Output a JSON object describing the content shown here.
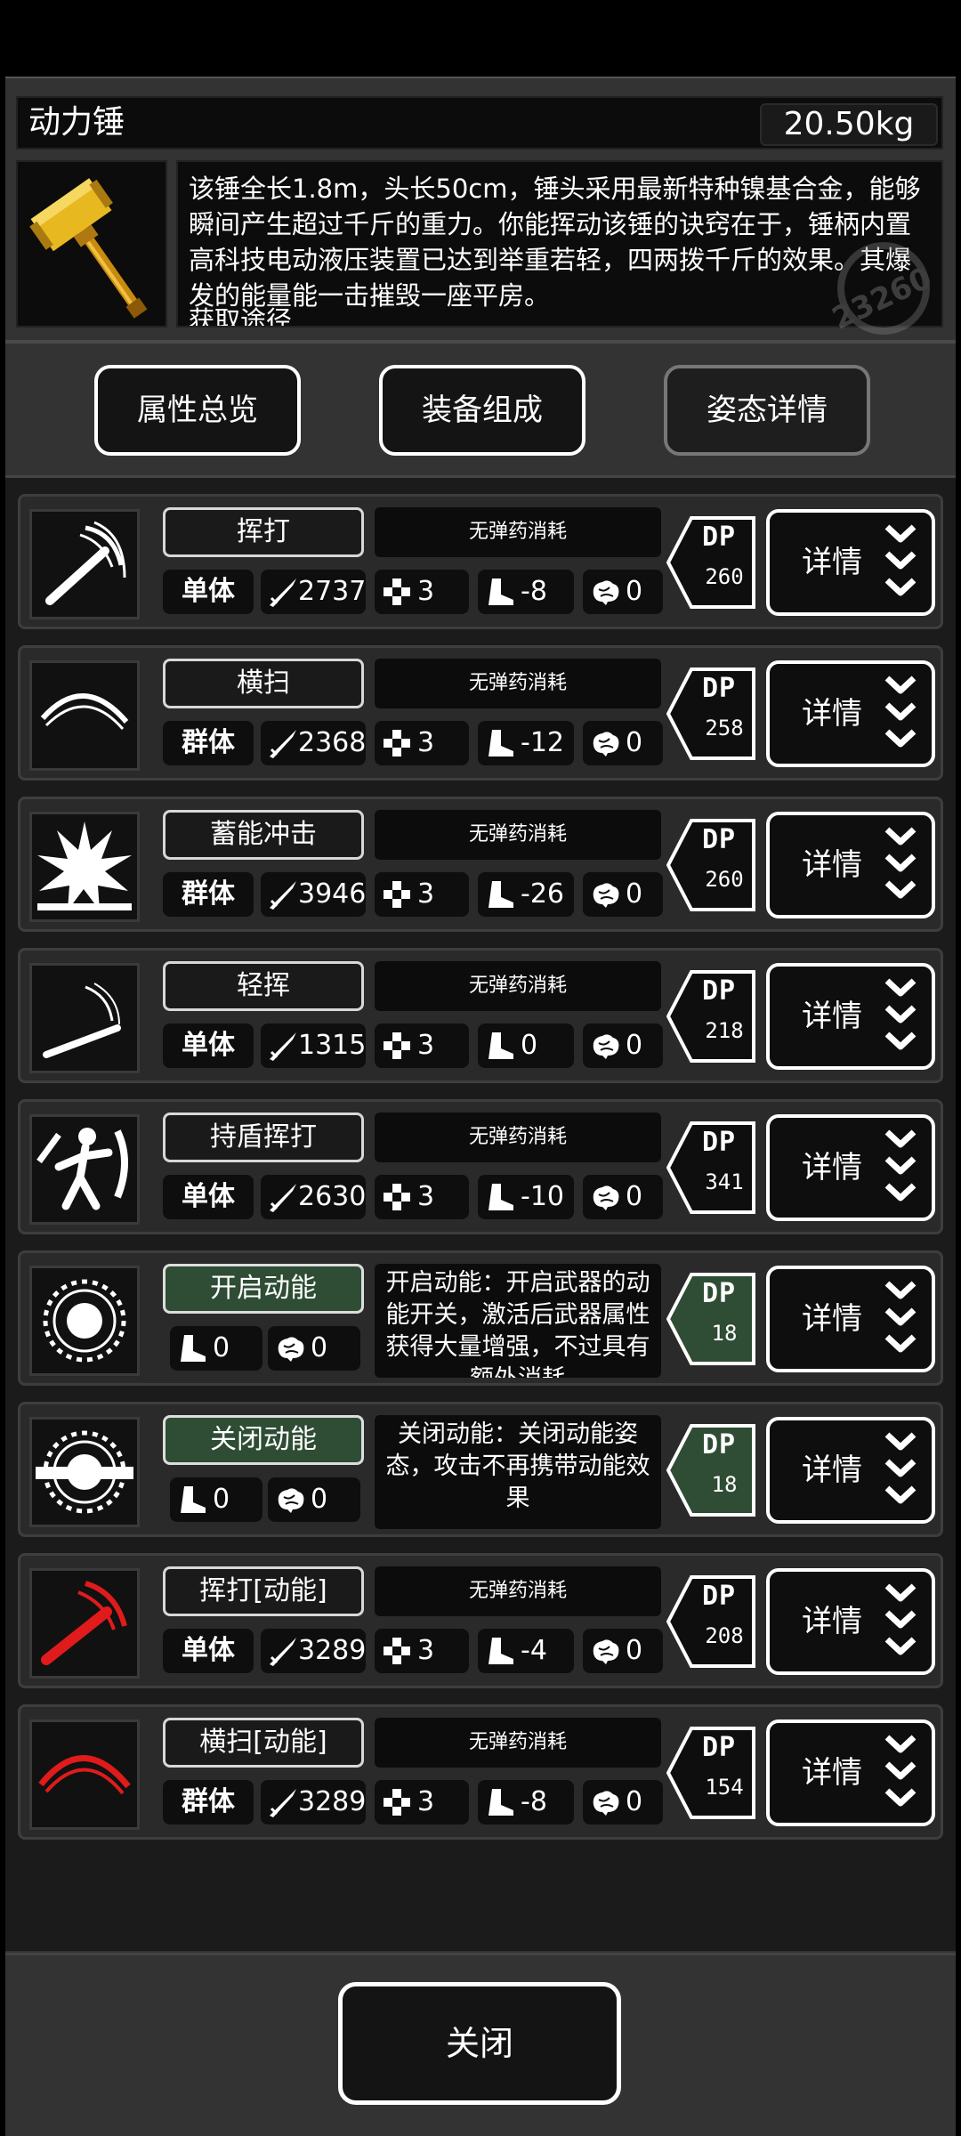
{
  "item": {
    "name": "动力锤",
    "weight": "20.50kg",
    "description": "该锤全长1.8m，头长50cm，锤头采用最新特种镍基合金，能够瞬间产生超过千斤的重力。你能挥动该锤的诀窍在于，锤柄内置高科技电动液压装置已达到举重若轻，四两拨千斤的效果。其爆发的能量能一击摧毁一座平房。",
    "description_cut": "获取途径",
    "watermark_number": "23260"
  },
  "tabs": [
    {
      "label": "属性总览"
    },
    {
      "label": "装备组成"
    },
    {
      "label": "姿态详情"
    }
  ],
  "dp_label": "DP",
  "detail_label": "详情",
  "skills": [
    {
      "name": "挥打",
      "desc": "无弹药消耗",
      "target": "单体",
      "atk": "2737",
      "hit": "3",
      "move": "-8",
      "brain": "0",
      "dp": "260",
      "icon": "swing-icon"
    },
    {
      "name": "横扫",
      "desc": "无弹药消耗",
      "target": "群体",
      "atk": "2368",
      "hit": "3",
      "move": "-12",
      "brain": "0",
      "dp": "258",
      "icon": "sweep-icon"
    },
    {
      "name": "蓄能冲击",
      "desc": "无弹药消耗",
      "target": "群体",
      "atk": "3946",
      "hit": "3",
      "move": "-26",
      "brain": "0",
      "dp": "260",
      "icon": "explosion-icon"
    },
    {
      "name": "轻挥",
      "desc": "无弹药消耗",
      "target": "单体",
      "atk": "1315",
      "hit": "3",
      "move": "0",
      "brain": "0",
      "dp": "218",
      "icon": "light-swing-icon"
    },
    {
      "name": "持盾挥打",
      "desc": "无弹药消耗",
      "target": "单体",
      "atk": "2630",
      "hit": "3",
      "move": "-10",
      "brain": "0",
      "dp": "341",
      "icon": "shield-swing-icon"
    },
    {
      "name": "开启动能",
      "desc": "开启动能：开启武器的动能开关，激活后武器属性获得大量增强，不过具有额外消耗",
      "move": "0",
      "brain": "0",
      "dp": "18",
      "icon": "power-on-icon"
    },
    {
      "name": "关闭动能",
      "desc": "关闭动能：关闭动能姿态，攻击不再携带动能效果",
      "move": "0",
      "brain": "0",
      "dp": "18",
      "icon": "power-off-icon"
    },
    {
      "name": "挥打[动能]",
      "desc": "无弹药消耗",
      "target": "单体",
      "atk": "3289",
      "hit": "3",
      "move": "-4",
      "brain": "0",
      "dp": "208",
      "icon": "powered-swing-icon"
    },
    {
      "name": "横扫[动能]",
      "desc": "无弹药消耗",
      "target": "群体",
      "atk": "3289",
      "hit": "3",
      "move": "-8",
      "brain": "0",
      "dp": "154",
      "icon": "powered-sweep-icon"
    }
  ],
  "close_label": "关闭",
  "colors": {
    "green_accent": "#2e4d34",
    "red_skill": "#e01b1b",
    "hammer_gold": "#e8b820"
  }
}
